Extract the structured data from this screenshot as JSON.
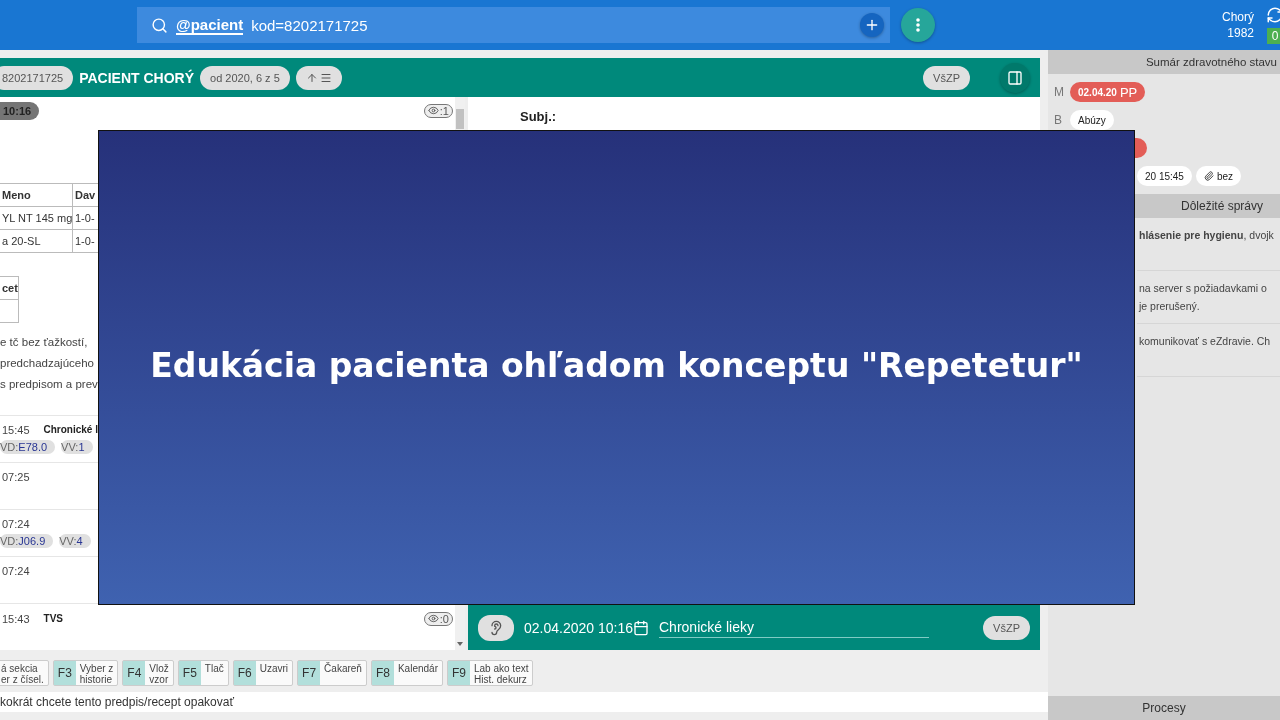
{
  "topbar": {
    "search": {
      "mention": "@pacient",
      "query": "kod=8202171725"
    },
    "user": {
      "name": "Chorý",
      "year": "1982"
    },
    "badge": "0"
  },
  "patient_bar": {
    "id": "8202171725",
    "name": "PACIENT CHORÝ",
    "range": "od 2020, 6 z 5",
    "insurer": "VšZP"
  },
  "record_list": {
    "time_pill": "10:16",
    "eye_count": ":1",
    "table": {
      "columns": [
        "Meno",
        "Dav"
      ],
      "rows": [
        [
          "YL NT 145 mg",
          "1-0-"
        ],
        [
          "a 20-SL",
          "1-0-"
        ]
      ]
    },
    "small_table": {
      "columns": [
        "cet"
      ]
    },
    "note_lines": [
      "e tč bez ťažkostí,",
      "predchadzajúceho",
      "s predpisom a prev"
    ],
    "entries": [
      {
        "time": "15:45",
        "title": "Chronické l",
        "chips": [
          {
            "label": "VD:",
            "value": "E78.0"
          },
          {
            "label": "VV:",
            "value": "1"
          }
        ]
      },
      {
        "time": "07:25"
      },
      {
        "time": "07:24",
        "chips": [
          {
            "label": "VD:",
            "value": "J06.9"
          },
          {
            "label": "VV:",
            "value": "4"
          }
        ]
      },
      {
        "time": "07:24"
      },
      {
        "time": "15:43",
        "title": "TVS",
        "eye_count": ":0"
      }
    ]
  },
  "editor": {
    "subject_label": "Subj.:",
    "footer": {
      "datetime": "02.04.2020 10:16",
      "section": "Chronické lieky",
      "insurer": "VšZP"
    }
  },
  "function_keys": [
    {
      "lines": [
        "á sekcia",
        "er z čísel."
      ]
    },
    {
      "key": "F3",
      "lines": [
        "Vyber z",
        "historie"
      ]
    },
    {
      "key": "F4",
      "lines": [
        "Vlož",
        "vzor"
      ]
    },
    {
      "key": "F5",
      "lines": [
        "Tlač"
      ]
    },
    {
      "key": "F6",
      "lines": [
        "Uzavri"
      ]
    },
    {
      "key": "F7",
      "lines": [
        "Čakareň"
      ]
    },
    {
      "key": "F8",
      "lines": [
        "Kalendár"
      ]
    },
    {
      "key": "F9",
      "lines": [
        "Lab ako text",
        "Hist. dekurz"
      ]
    }
  ],
  "status_text": "kokrát chcete tento predpis/recept opakovať",
  "sidebar": {
    "summary_title": "Sumár zdravotného stavu",
    "summary_rows": [
      {
        "letter": "M",
        "chips": [
          {
            "kind": "alert",
            "text": "02.04.20",
            "suffix": "PP"
          }
        ]
      },
      {
        "letter": "B",
        "chips": [
          {
            "kind": "plain",
            "text": "Abúzy"
          }
        ]
      },
      {
        "chips": [
          {
            "kind": "alert"
          }
        ]
      },
      {
        "chips": [
          {
            "kind": "plain",
            "text": "20 15:45"
          },
          {
            "kind": "attachment",
            "text": "bez"
          }
        ]
      }
    ],
    "messages_title": "Dôležité správy",
    "messages": [
      {
        "lines": [
          "**hlásenie pre hygienu**, dvojk"
        ]
      },
      {
        "lines": [
          "na server s požiadavkami o",
          "je prerušený."
        ]
      },
      {
        "lines": [
          "komunikovať s eZdravie. Ch"
        ]
      }
    ],
    "processes_title": "Procesy"
  },
  "slide": {
    "title": "Edukácia pacienta ohľadom konceptu \"Repetetur\""
  }
}
